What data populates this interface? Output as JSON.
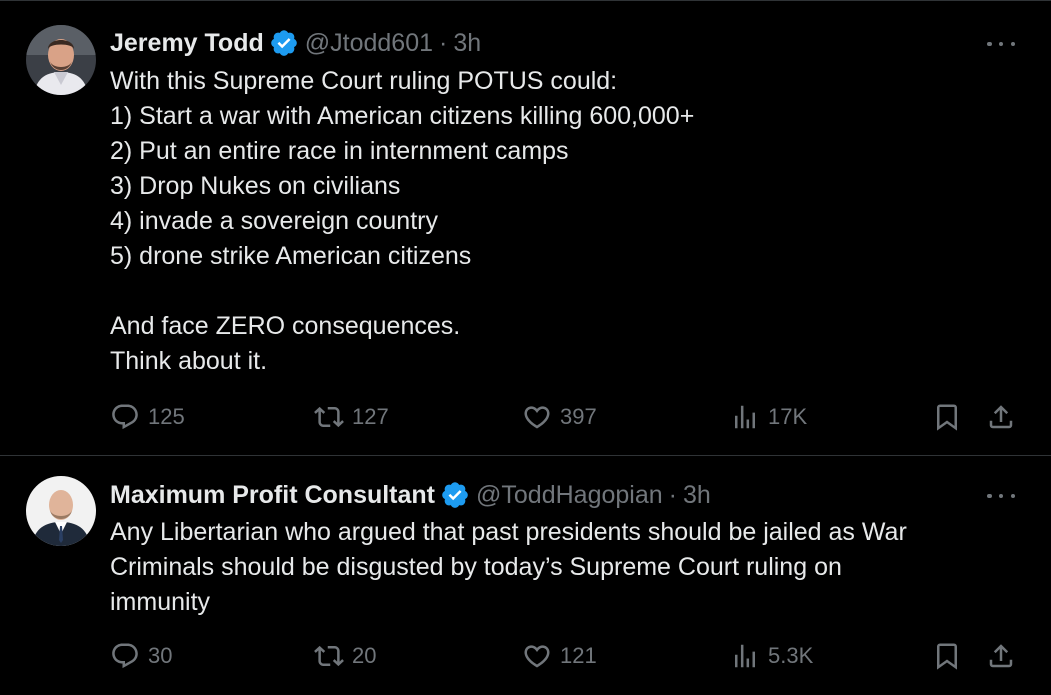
{
  "tweets": [
    {
      "display_name": "Jeremy Todd",
      "verified": true,
      "handle": "@Jtodd601",
      "separator": "·",
      "time": "3h",
      "body_lines": [
        "With this Supreme Court ruling POTUS could:",
        "1) Start a war with American citizens killing 600,000+",
        "2) Put an entire race in internment camps",
        "3) Drop Nukes on civilians",
        "4) invade a sovereign country",
        "5) drone strike American citizens",
        "",
        "And face ZERO consequences.",
        "Think about it."
      ],
      "replies": "125",
      "reposts": "127",
      "likes": "397",
      "views": "17K"
    },
    {
      "display_name": "Maximum Profit Consultant",
      "verified": true,
      "handle": "@ToddHagopian",
      "separator": "·",
      "time": "3h",
      "body_lines": [
        "Any Libertarian who argued that past presidents should be jailed as War",
        "Criminals should be disgusted by today’s Supreme Court ruling on",
        "immunity"
      ],
      "replies": "30",
      "reposts": "20",
      "likes": "121",
      "views": "5.3K"
    }
  ],
  "icons": {
    "verified": "verified-badge-icon",
    "more": "more-icon",
    "reply": "reply-icon",
    "repost": "repost-icon",
    "like": "like-icon",
    "views": "views-icon",
    "bookmark": "bookmark-icon",
    "share": "share-icon"
  },
  "colors": {
    "background": "#000000",
    "text": "#e7e9ea",
    "muted": "#71767b",
    "verified": "#1d9bf0",
    "divider": "#2f3336"
  }
}
